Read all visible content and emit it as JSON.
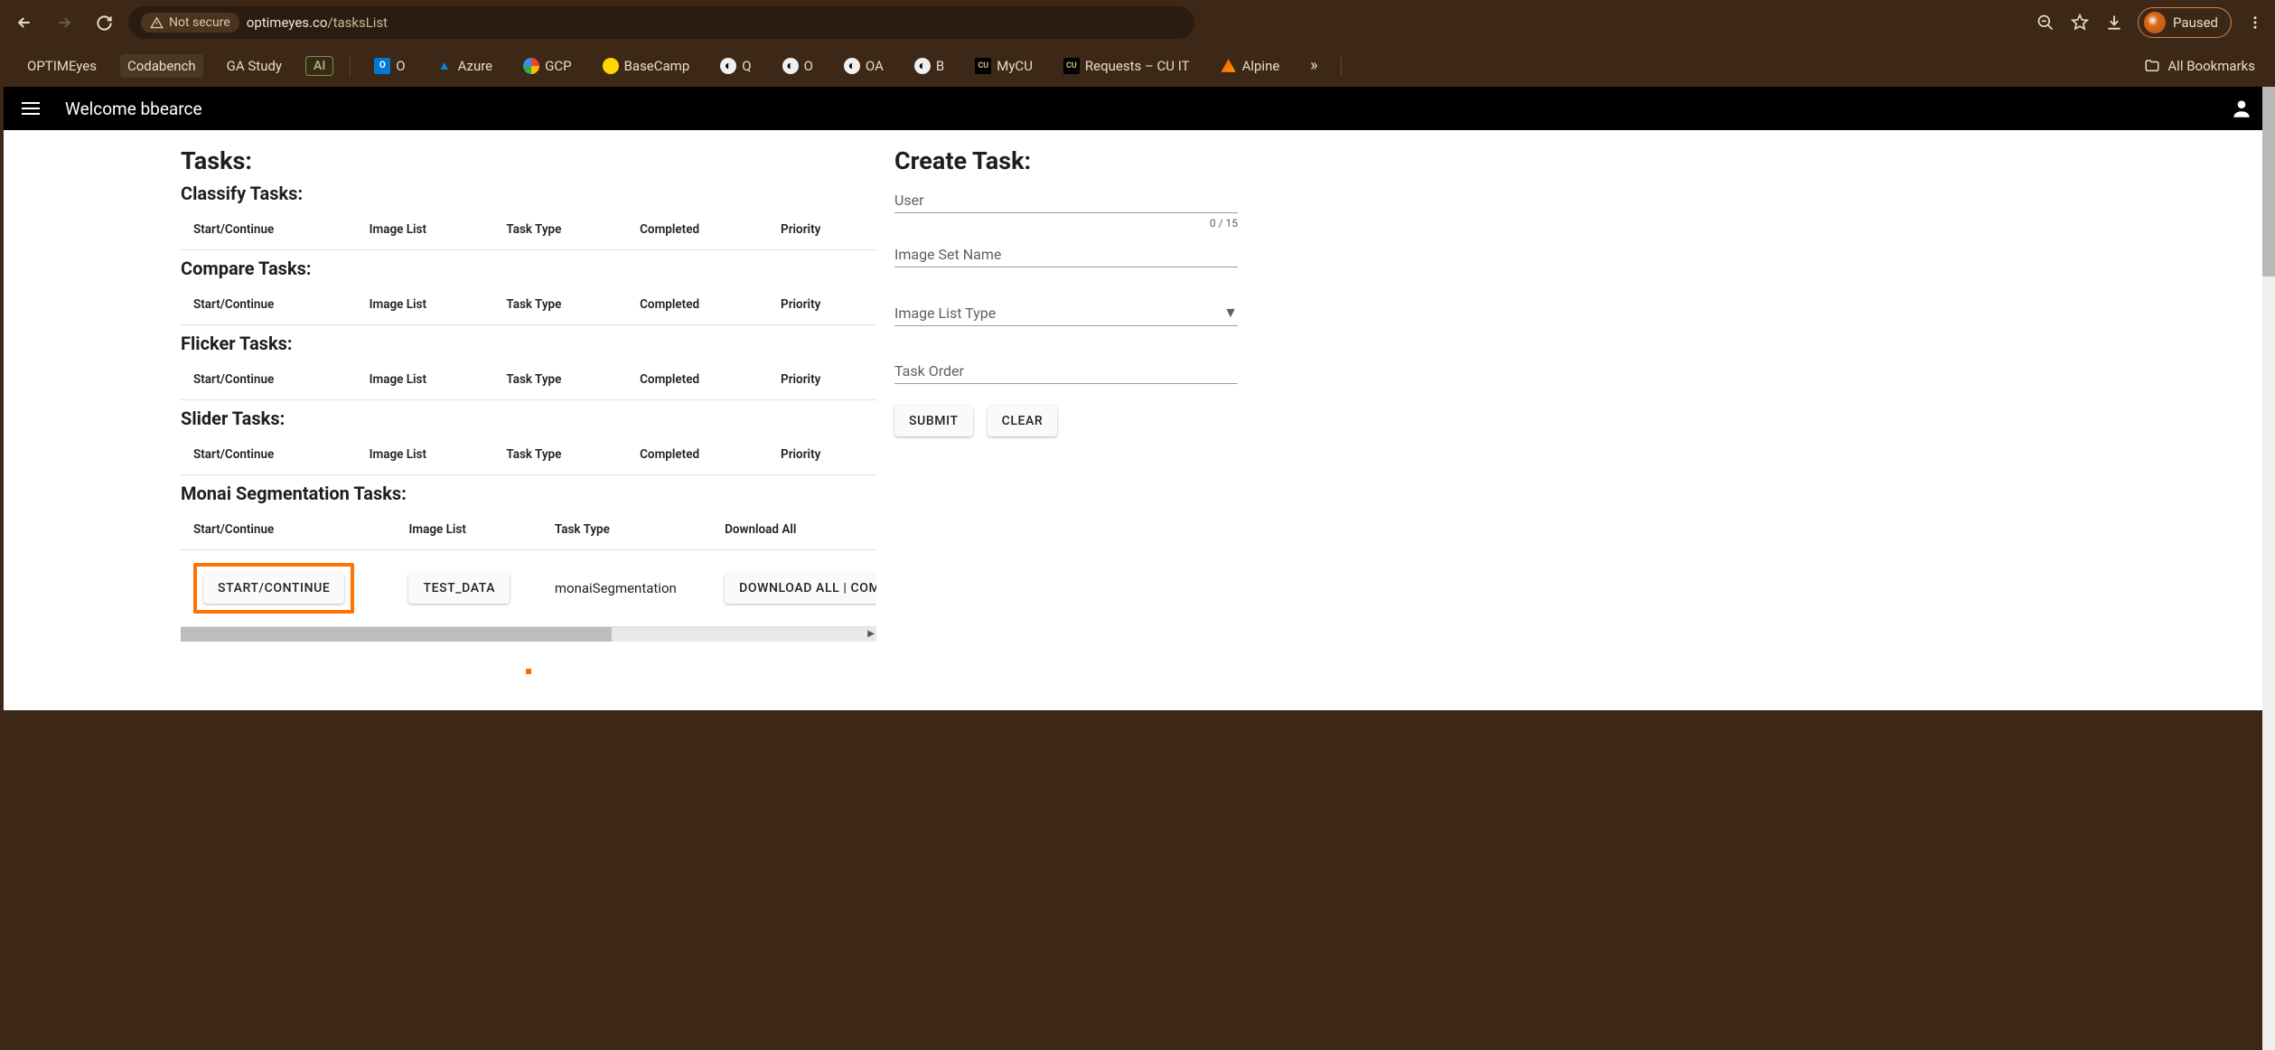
{
  "browser": {
    "not_secure": "Not secure",
    "url_host": "optimeyes.co",
    "url_path": "/tasksList",
    "paused": "Paused"
  },
  "bookmarks": {
    "items": [
      "OPTIMEyes",
      "Codabench",
      "GA Study"
    ],
    "ai": "AI",
    "iconed": [
      {
        "label": "O"
      },
      {
        "label": "Azure"
      },
      {
        "label": "GCP"
      },
      {
        "label": "BaseCamp"
      },
      {
        "label": "Q"
      },
      {
        "label": "O"
      },
      {
        "label": "OA"
      },
      {
        "label": "B"
      },
      {
        "label": "MyCU"
      },
      {
        "label": "Requests – CU IT"
      },
      {
        "label": "Alpine"
      }
    ],
    "all": "All Bookmarks"
  },
  "topbar": {
    "welcome": "Welcome bbearce"
  },
  "tasks": {
    "heading": "Tasks:",
    "sections": {
      "classify": "Classify Tasks:",
      "compare": "Compare Tasks:",
      "flicker": "Flicker Tasks:",
      "slider": "Slider Tasks:",
      "monai": "Monai Segmentation Tasks:"
    },
    "columns": {
      "start": "Start/Continue",
      "imagelist": "Image List",
      "type": "Task Type",
      "completed": "Completed",
      "priority": "Priority",
      "download": "Download All"
    },
    "monai_row": {
      "start_btn": "START/CONTINUE",
      "imagelist_btn": "TEST_DATA",
      "type": "monaiSegmentation",
      "download_btn": "DOWNLOAD ALL | COMPLETED"
    }
  },
  "create": {
    "heading": "Create Task:",
    "fields": {
      "user": "User",
      "user_counter": "0 / 15",
      "imageset": "Image Set Name",
      "listtype": "Image List Type",
      "taskorder": "Task Order"
    },
    "buttons": {
      "submit": "SUBMIT",
      "clear": "CLEAR"
    }
  }
}
